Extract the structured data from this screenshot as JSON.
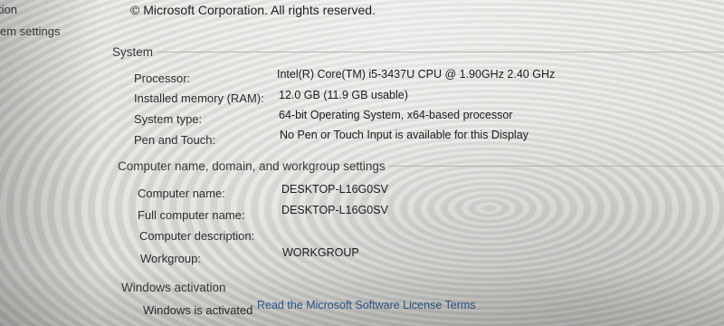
{
  "left_nav": {
    "items": [
      {
        "label": "tion"
      },
      {
        "label": "em settings"
      }
    ]
  },
  "copyright": "© Microsoft Corporation. All rights reserved.",
  "system": {
    "header": "System",
    "rows": [
      {
        "label": "Processor:",
        "value": "Intel(R) Core(TM) i5-3437U CPU @ 1.90GHz   2.40 GHz"
      },
      {
        "label": "Installed memory (RAM):",
        "value": "12.0 GB (11.9 GB usable)"
      },
      {
        "label": "System type:",
        "value": "64-bit Operating System, x64-based processor"
      },
      {
        "label": "Pen and Touch:",
        "value": "No Pen or Touch Input is available for this Display"
      }
    ]
  },
  "computer": {
    "header": "Computer name, domain, and workgroup settings",
    "rows": [
      {
        "label": "Computer name:",
        "value": "DESKTOP-L16G0SV"
      },
      {
        "label": "Full computer name:",
        "value": "DESKTOP-L16G0SV"
      },
      {
        "label": "Computer description:",
        "value": ""
      },
      {
        "label": "Workgroup:",
        "value": "WORKGROUP"
      }
    ]
  },
  "activation": {
    "header": "Windows activation",
    "status": "Windows is activated",
    "license_link": "Read the Microsoft Software License Terms"
  }
}
